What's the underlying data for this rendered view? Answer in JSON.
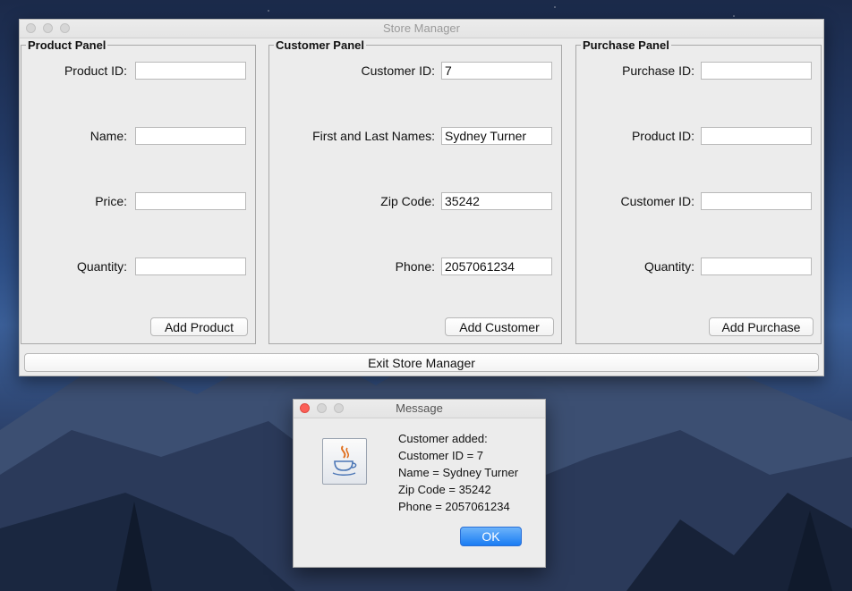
{
  "main_window": {
    "title": "Store Manager",
    "product_panel": {
      "title": "Product Panel",
      "fields": [
        {
          "label": "Product ID:",
          "value": ""
        },
        {
          "label": "Name:",
          "value": ""
        },
        {
          "label": "Price:",
          "value": ""
        },
        {
          "label": "Quantity:",
          "value": ""
        }
      ],
      "button": "Add Product"
    },
    "customer_panel": {
      "title": "Customer Panel",
      "fields": [
        {
          "label": "Customer ID:",
          "value": "7"
        },
        {
          "label": "First and Last Names:",
          "value": "Sydney Turner"
        },
        {
          "label": "Zip Code:",
          "value": "35242"
        },
        {
          "label": "Phone:",
          "value": "2057061234"
        }
      ],
      "button": "Add Customer"
    },
    "purchase_panel": {
      "title": "Purchase Panel",
      "fields": [
        {
          "label": "Purchase ID:",
          "value": ""
        },
        {
          "label": "Product ID:",
          "value": ""
        },
        {
          "label": "Customer ID:",
          "value": ""
        },
        {
          "label": "Quantity:",
          "value": ""
        }
      ],
      "button": "Add Purchase"
    },
    "exit_button": "Exit Store Manager"
  },
  "dialog": {
    "title": "Message",
    "icon": "java-cup-icon",
    "lines": [
      "Customer added:",
      "Customer ID = 7",
      "Name = Sydney Turner",
      "Zip Code = 35242",
      "Phone = 2057061234"
    ],
    "ok_button": "OK"
  },
  "colors": {
    "ok_button": "#1a7cf3",
    "close_light": "#fc5f57"
  }
}
